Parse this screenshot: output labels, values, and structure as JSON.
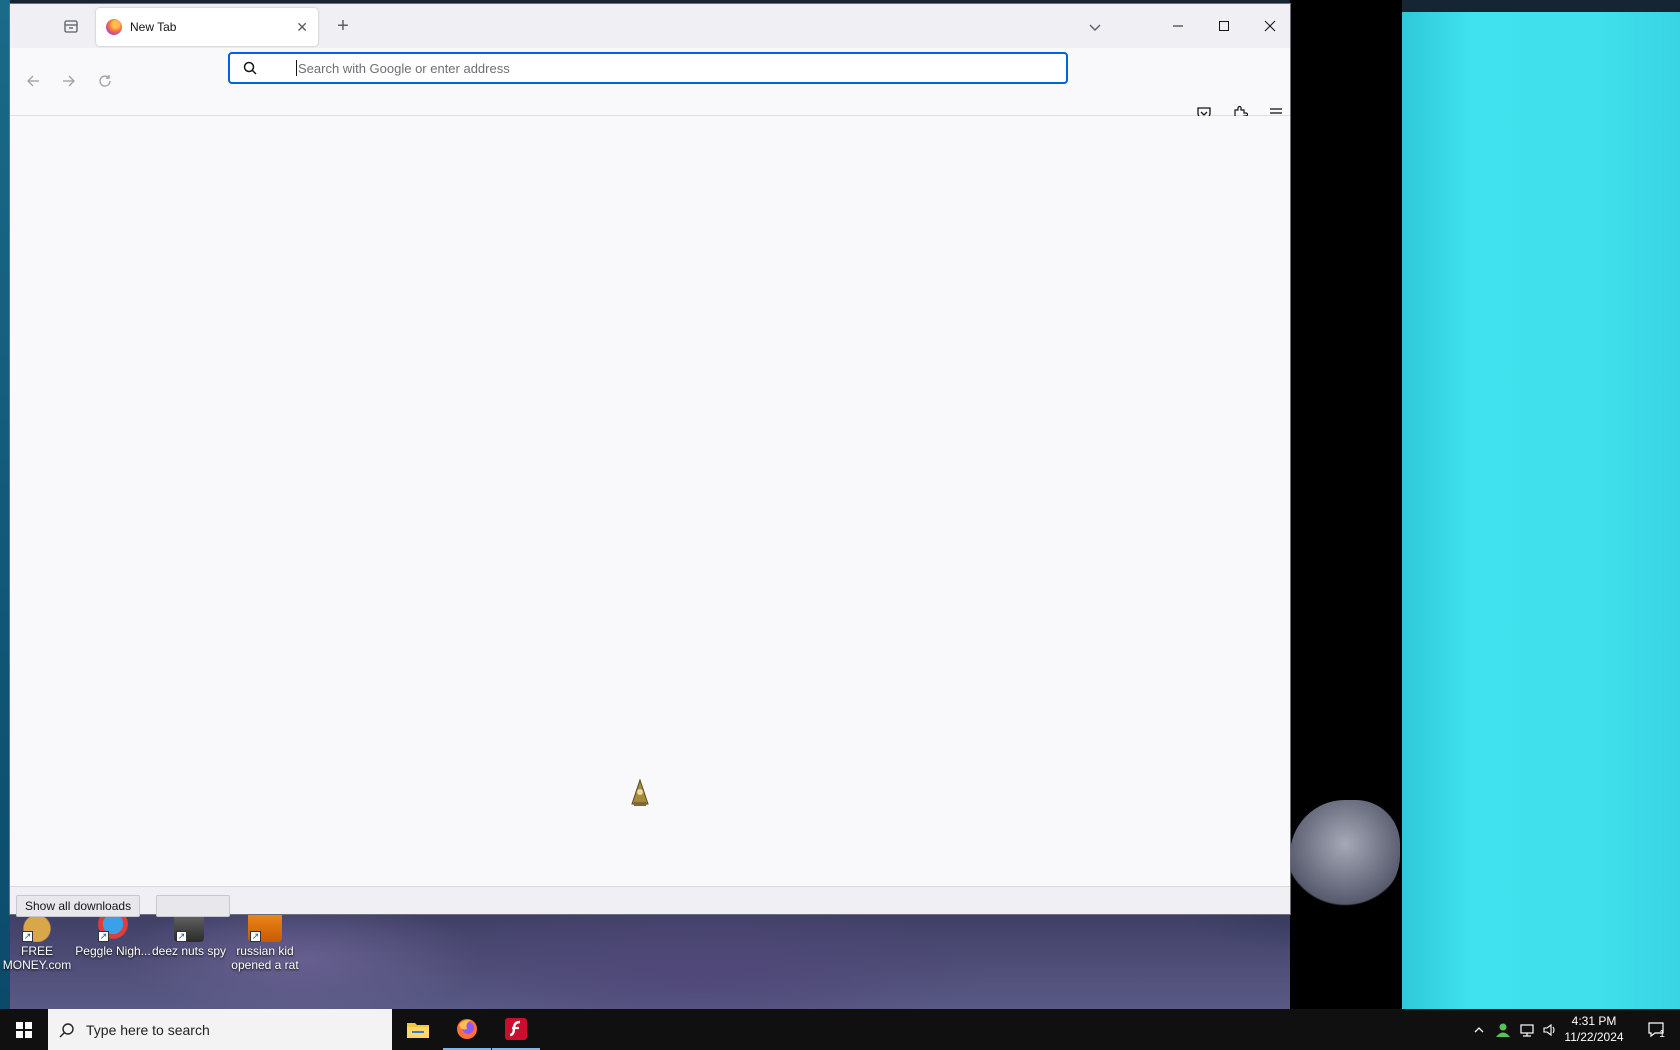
{
  "browser": {
    "tab": {
      "title": "New Tab"
    },
    "urlbar": {
      "placeholder": "Search with Google or enter address",
      "value": ""
    },
    "downloads": {
      "show_all_label": "Show all downloads"
    }
  },
  "desktop_icons": [
    {
      "label": "FREE MONEY.com"
    },
    {
      "label": "Peggle Nigh..."
    },
    {
      "label": "deez nuts spy"
    },
    {
      "label": "russian kid opened a rat"
    }
  ],
  "taskbar": {
    "search_placeholder": "Type here to search",
    "apps": [
      "file-explorer-icon",
      "firefox-icon",
      "flash-player-icon"
    ],
    "clock": {
      "time": "4:31 PM",
      "date": "11/22/2024"
    },
    "notification_count": "1"
  },
  "colors": {
    "accent": "#0061e0",
    "taskbar": "#101010",
    "desktop_cyan": "#40e0ec"
  }
}
